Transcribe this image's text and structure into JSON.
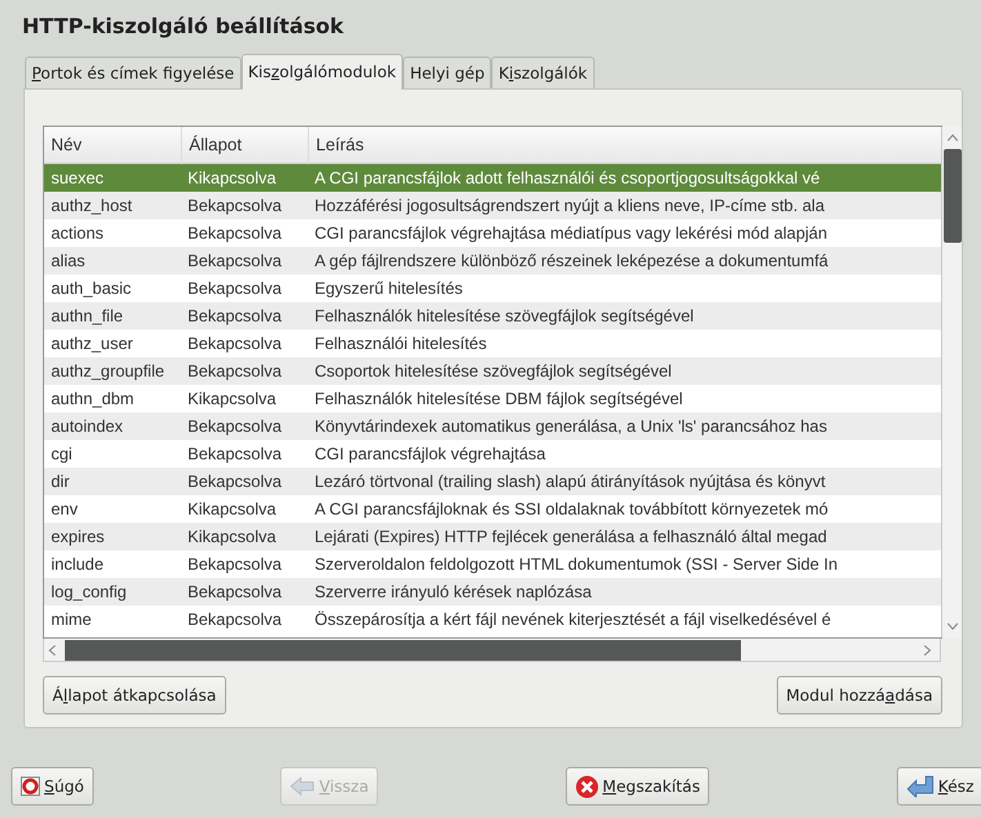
{
  "title": "HTTP-kiszolgáló beállítások",
  "tabs": [
    {
      "label": [
        {
          "text": "P",
          "underlined": true
        },
        {
          "text": "ortok és címek figyelése",
          "underlined": false
        }
      ],
      "selected": false
    },
    {
      "label": [
        {
          "text": "Kis",
          "underlined": false
        },
        {
          "text": "z",
          "underlined": true
        },
        {
          "text": "olgálómodulok",
          "underlined": false
        }
      ],
      "selected": true
    },
    {
      "label": [
        {
          "text": "Helyi gép",
          "underlined": false
        }
      ],
      "selected": false
    },
    {
      "label": [
        {
          "text": "K",
          "underlined": false
        },
        {
          "text": "i",
          "underlined": true
        },
        {
          "text": "szolgálók",
          "underlined": false
        }
      ],
      "selected": false
    }
  ],
  "table": {
    "columns": [
      "Név",
      "Állapot",
      "Leírás"
    ],
    "rows": [
      {
        "name": "suexec",
        "state": "Kikapcsolva",
        "description": "A CGI parancsfájlok adott felhasználói és csoportjogosultságokkal vé",
        "selected": true
      },
      {
        "name": "authz_host",
        "state": "Bekapcsolva",
        "description": "Hozzáférési jogosultságrendszert nyújt a kliens neve, IP-címe stb. ala",
        "selected": false
      },
      {
        "name": "actions",
        "state": "Bekapcsolva",
        "description": "CGI parancsfájlok végrehajtása médiatípus vagy lekérési mód alapján",
        "selected": false
      },
      {
        "name": "alias",
        "state": "Bekapcsolva",
        "description": "A gép fájlrendszere különböző részeinek leképezése a dokumentumfá",
        "selected": false
      },
      {
        "name": "auth_basic",
        "state": "Bekapcsolva",
        "description": "Egyszerű hitelesítés",
        "selected": false
      },
      {
        "name": "authn_file",
        "state": "Bekapcsolva",
        "description": "Felhasználók hitelesítése szövegfájlok segítségével",
        "selected": false
      },
      {
        "name": "authz_user",
        "state": "Bekapcsolva",
        "description": "Felhasználói hitelesítés",
        "selected": false
      },
      {
        "name": "authz_groupfile",
        "state": "Bekapcsolva",
        "description": "Csoportok hitelesítése szövegfájlok segítségével",
        "selected": false
      },
      {
        "name": "authn_dbm",
        "state": "Kikapcsolva",
        "description": "Felhasználók hitelesítése DBM fájlok segítségével",
        "selected": false
      },
      {
        "name": "autoindex",
        "state": "Bekapcsolva",
        "description": "Könyvtárindexek automatikus generálása, a Unix 'ls' parancsához has",
        "selected": false
      },
      {
        "name": "cgi",
        "state": "Bekapcsolva",
        "description": "CGI parancsfájlok végrehajtása",
        "selected": false
      },
      {
        "name": "dir",
        "state": "Bekapcsolva",
        "description": "Lezáró törtvonal (trailing slash) alapú átirányítások nyújtása és könyvt",
        "selected": false
      },
      {
        "name": "env",
        "state": "Kikapcsolva",
        "description": "A CGI parancsfájloknak és SSI oldalaknak továbbított környezetek mó",
        "selected": false
      },
      {
        "name": "expires",
        "state": "Kikapcsolva",
        "description": "Lejárati (Expires) HTTP fejlécek generálása a felhasználó által megad",
        "selected": false
      },
      {
        "name": "include",
        "state": "Bekapcsolva",
        "description": "Szerveroldalon feldolgozott HTML dokumentumok (SSI - Server Side In",
        "selected": false
      },
      {
        "name": "log_config",
        "state": "Bekapcsolva",
        "description": "Szerverre irányuló kérések naplózása",
        "selected": false
      },
      {
        "name": "mime",
        "state": "Bekapcsolva",
        "description": "Összepárosítja a kért fájl nevének kiterjesztését a fájl viselkedésével é",
        "selected": false
      }
    ]
  },
  "panel_buttons": [
    {
      "label": [
        {
          "text": "Á",
          "underlined": false
        },
        {
          "text": "l",
          "underlined": true
        },
        {
          "text": "lapot átkapcsolása",
          "underlined": false
        }
      ]
    },
    {
      "label": [
        {
          "text": "Modul hozzá",
          "underlined": false
        },
        {
          "text": "a",
          "underlined": true
        },
        {
          "text": "dása",
          "underlined": false
        }
      ]
    }
  ],
  "footer_buttons": [
    {
      "kind": "help",
      "label": [
        {
          "text": "S",
          "underlined": true
        },
        {
          "text": "úgó",
          "underlined": false
        }
      ],
      "disabled": false
    },
    {
      "kind": "back",
      "label": [
        {
          "text": "V",
          "underlined": true
        },
        {
          "text": "issza",
          "underlined": false
        }
      ],
      "disabled": true
    },
    {
      "kind": "cancel",
      "label": [
        {
          "text": "M",
          "underlined": true
        },
        {
          "text": "egszakítás",
          "underlined": false
        }
      ],
      "disabled": false
    },
    {
      "kind": "finish",
      "label": [
        {
          "text": "K",
          "underlined": true
        },
        {
          "text": "ész",
          "underlined": false
        }
      ],
      "disabled": false
    }
  ]
}
